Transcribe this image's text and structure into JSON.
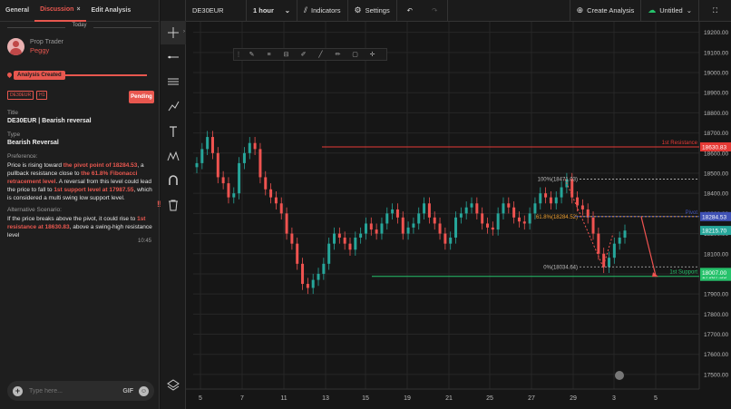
{
  "left_panel": {
    "tabs": [
      {
        "label": "General"
      },
      {
        "label": "Discussion",
        "close": "×"
      },
      {
        "label": "Edit Analysis"
      }
    ],
    "day_label": "Today",
    "user": {
      "role": "Prop Trader",
      "name": "Peggy"
    },
    "status_label": "Analysis Created",
    "badges": [
      "DE30EUR",
      "H1"
    ],
    "pending_label": "Pending",
    "title_label": "Title",
    "title_value": "DE30EUR | Bearish reversal",
    "type_label": "Type",
    "type_value": "Bearish Reversal",
    "preference_label": "Preference:",
    "pref": {
      "p1": "Price is rising toward ",
      "h1": "the pivot point of 18284.53",
      "p2": ", a pullback resistance close to ",
      "h2": "the 61.8% Fibonacci retracement level",
      "p3": ". A reversal from this level could lead the price to fall to ",
      "h3": "1st support level at 17987.55",
      "p4": ", which is considered a multi swing low support level."
    },
    "alt_label": "Alternative Scenario:",
    "alt": {
      "p1": "If the price breaks above the pivot, it could rise to ",
      "h1": "1st resistance at 18630.83",
      "p2": ", above a swing-high resistance level"
    },
    "time": "10:45",
    "input_placeholder": "Type here...",
    "gif_label": "GIF",
    "collapse_icon": "‼"
  },
  "topbar": {
    "symbol": "DE30EUR",
    "interval": "1 hour",
    "indicators": "Indicators",
    "settings": "Settings",
    "create": "Create Analysis",
    "untitled": "Untitled",
    "icons": [
      "chevron-down-icon",
      "indicators-icon",
      "gear-icon",
      "undo-icon",
      "redo-icon",
      "plus-circle-icon",
      "cloud-icon",
      "fullscreen-icon"
    ]
  },
  "toolbar": {
    "tools": [
      "crosshair-icon",
      "horizontal-line-icon",
      "parallel-channel-icon",
      "brush-icon",
      "text-icon",
      "pattern-icon",
      "magnet-icon",
      "trash-icon",
      "layers-icon"
    ]
  },
  "colors": {
    "accent": "#e8574f",
    "up": "#26a69a",
    "down": "#ef5350",
    "resistance": "#e53935",
    "pivot": "#3f51b5",
    "support": "#26c26b",
    "fib": "#f0a030"
  },
  "chart_data": {
    "type": "candlestick",
    "y_axis": {
      "ylim": [
        17450,
        19230
      ],
      "ticks": [
        "19200.00",
        "19100.00",
        "19000.00",
        "18900.00",
        "18800.00",
        "18700.00",
        "18600.00",
        "18500.00",
        "18400.00",
        "18300.00",
        "18200.00",
        "18100.00",
        "18000.00",
        "17900.00",
        "17800.00",
        "17700.00",
        "17600.00",
        "17500.00"
      ]
    },
    "x_axis": {
      "ticks": [
        "5",
        "7",
        "11",
        "13",
        "15",
        "19",
        "21",
        "25",
        "27",
        "29",
        "3",
        "5"
      ]
    },
    "levels": [
      {
        "label": "1st Resistance",
        "value": 18630.83,
        "tag": "18630.83"
      },
      {
        "label": "Pivot",
        "value": 18284.53,
        "tag": "18284.53"
      },
      {
        "label": "1st Support",
        "value": 17987.55,
        "tag": "17987.55"
      }
    ],
    "price_tags": [
      "18215.70",
      "18007.00"
    ],
    "fib_labels": [
      "100%(18471.03)",
      "61.8%(18284.52)",
      "0%(18034.64)"
    ],
    "path_points": [
      18550,
      18620,
      18680,
      18600,
      18480,
      18450,
      18380,
      18400,
      18550,
      18600,
      18650,
      18620,
      18480,
      18420,
      18380,
      18350,
      18300,
      18200,
      18150,
      18050,
      17950,
      17930,
      17970,
      18000,
      18050,
      18150,
      18200,
      18180,
      18150,
      18120,
      18180,
      18200,
      18250,
      18220,
      18200,
      18250,
      18300,
      18320,
      18280,
      18200,
      18230,
      18250,
      18300,
      18350,
      18280,
      18250,
      18200,
      18150,
      18180,
      18280,
      18300,
      18330,
      18350,
      18300,
      18250,
      18230,
      18220,
      18300,
      18350,
      18330,
      18280,
      18260,
      18250,
      18300,
      18350,
      18400,
      18380,
      18350,
      18380,
      18430,
      18471,
      18380,
      18340,
      18320,
      18280,
      18200,
      18100,
      18034,
      18080,
      18150,
      18180,
      18215
    ]
  }
}
